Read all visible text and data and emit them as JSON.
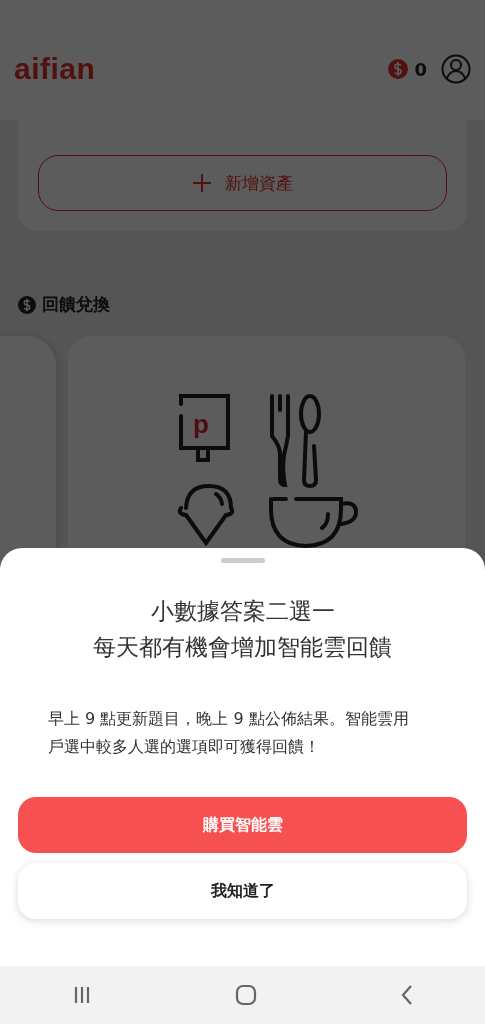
{
  "header": {
    "logo": "aifian",
    "points": "0"
  },
  "asset_card": {
    "add_button": "新增資產"
  },
  "section": {
    "title": "回饋兌換",
    "promo_logo": "p"
  },
  "sheet": {
    "title_lines": [
      "小數據答案二選一",
      "每天都有機會增加智能雲回饋"
    ],
    "body": "早上 9 點更新題目，晚上 9 點公佈結果。智能雲用戶選中較多人選的選項即可獲得回饋！",
    "buttons": [
      {
        "label": "購買智能雲",
        "kind": "primary"
      },
      {
        "label": "我知道了",
        "kind": "secondary"
      }
    ]
  }
}
